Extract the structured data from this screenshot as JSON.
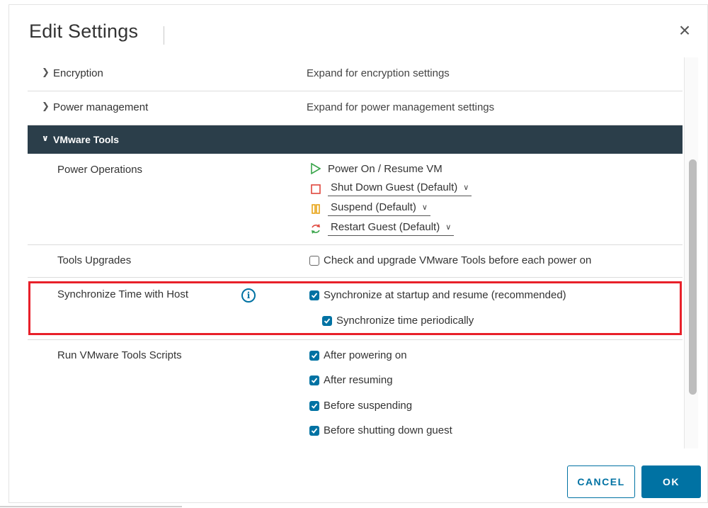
{
  "dialog": {
    "title": "Edit Settings",
    "close_glyph": "×"
  },
  "rows": {
    "encryption": {
      "label": "Encryption",
      "value": "Expand for encryption settings"
    },
    "power_management": {
      "label": "Power management",
      "value": "Expand for power management settings"
    }
  },
  "vmware_tools": {
    "header": "VMware Tools",
    "power_operations": {
      "label": "Power Operations",
      "power_on": "Power On / Resume VM",
      "shut_down": "Shut Down Guest (Default)",
      "suspend": "Suspend (Default)",
      "restart": "Restart Guest (Default)"
    },
    "tools_upgrades": {
      "label": "Tools Upgrades",
      "option": "Check and upgrade VMware Tools before each power on",
      "checked": false
    },
    "sync_time": {
      "label": "Synchronize Time with Host",
      "startup": "Synchronize at startup and resume (recommended)",
      "periodic": "Synchronize time periodically"
    },
    "scripts": {
      "label": "Run VMware Tools Scripts",
      "after_power_on": "After powering on",
      "after_resume": "After resuming",
      "before_suspend": "Before suspending",
      "before_shutdown": "Before shutting down guest"
    }
  },
  "buttons": {
    "cancel": "CANCEL",
    "ok": "OK"
  },
  "colors": {
    "accent": "#0072a3",
    "header_bg": "#2b3e4a",
    "highlight": "#e8202a",
    "power_on_green": "#3aa54b",
    "shutdown_red": "#e0463c",
    "suspend_orange": "#e8a317"
  },
  "icons": {
    "power_on": "play-triangle-icon",
    "shut_down": "stop-square-icon",
    "suspend": "pause-bars-icon",
    "restart": "restart-arrows-icon",
    "info": "info-circle-icon"
  }
}
